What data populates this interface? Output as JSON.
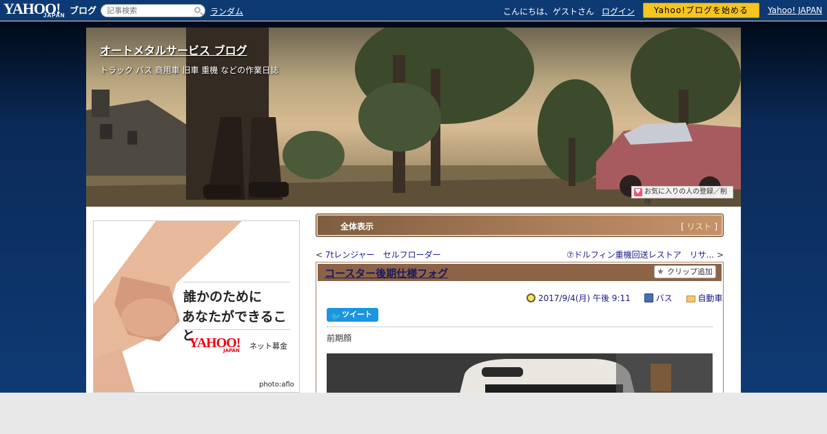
{
  "topbar": {
    "logo_main": "YAHOO!",
    "logo_jp": "JAPAN",
    "logo_blog": "ブログ",
    "search_placeholder": "記事検索",
    "random_label": "ランダム",
    "greeting": "こんにちは、ゲストさん",
    "login_label": "ログイン",
    "start_button": "Yahoo!ブログを始める",
    "yahoo_japan_link": "Yahoo! JAPAN"
  },
  "header": {
    "title": "オートメタルサービス ブログ",
    "description": "トラック バス 商用車 旧車 重機 などの作業日誌",
    "favorite_button": "お気に入りの人の登録／削除"
  },
  "ad": {
    "line1": "誰かのために",
    "line2": "あなたができること",
    "logo": "YAHOO!",
    "logo_jp": "JAPAN",
    "service": "ネット募金",
    "credit": "photo:aflo"
  },
  "tabs": {
    "all_label": "全体表示",
    "list_prefix": "[ ",
    "list_label": "リスト",
    "list_suffix": " ]"
  },
  "nav": {
    "prev_arrow": "<",
    "prev_label": "7tレンジャー　セルフローダー",
    "next_label": "⑦ドルフィン重機回送レストア　リサ...",
    "next_arrow": ">"
  },
  "article": {
    "title": "コースター後期仕様フォグ",
    "clip_label": "クリップ追加",
    "date": "2017/9/4(月) 午後 9:11",
    "category": "バス",
    "folder": "自動車",
    "tweet_label": "ツイート",
    "body": "前期顔"
  },
  "colors": {
    "topbar": "#0d3a73",
    "start_button": "#f7c51e",
    "tab_brown": "#8b6347",
    "tweet": "#1b95e0"
  }
}
